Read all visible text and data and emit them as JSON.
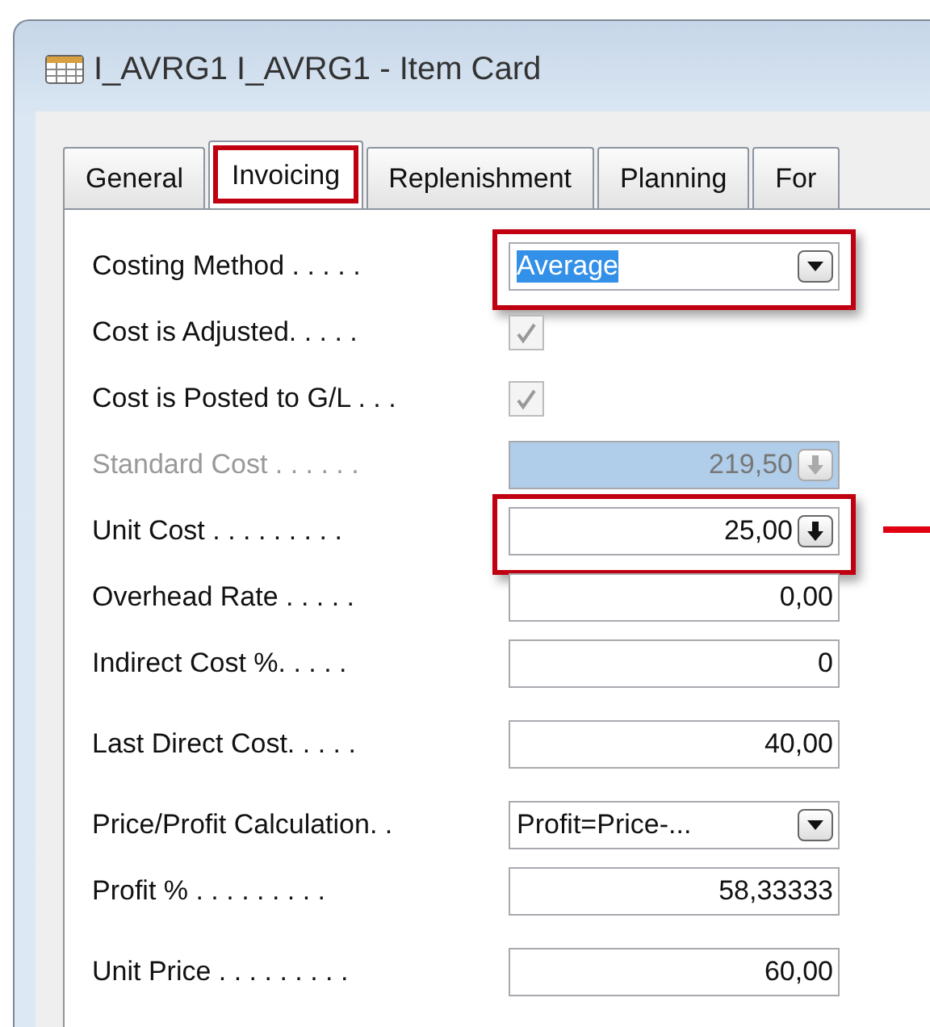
{
  "window": {
    "title": "I_AVRG1 I_AVRG1 - Item Card"
  },
  "tabs": [
    {
      "label": "General",
      "selected": false,
      "highlighted": false
    },
    {
      "label": "Invoicing",
      "selected": true,
      "highlighted": true
    },
    {
      "label": "Replenishment",
      "selected": false,
      "highlighted": false
    },
    {
      "label": "Planning",
      "selected": false,
      "highlighted": false
    },
    {
      "label": "For",
      "selected": false,
      "highlighted": false
    }
  ],
  "fields": [
    {
      "label": "Costing Method . . . . .",
      "kind": "dropdown",
      "value": "Average",
      "text_selected": true,
      "disabled": false,
      "highlighted": true,
      "pointer": false
    },
    {
      "label": "Cost is Adjusted. . . . .",
      "kind": "checkbox",
      "checked": true,
      "disabled": true,
      "highlighted": false,
      "pointer": false
    },
    {
      "label": "Cost is Posted to G/L . . .",
      "kind": "checkbox",
      "checked": true,
      "disabled": true,
      "highlighted": false,
      "pointer": false
    },
    {
      "label": "Standard Cost . . . . . .",
      "kind": "lookup",
      "value": "219,50",
      "disabled": true,
      "highlighted": false,
      "pointer": false
    },
    {
      "label": "Unit Cost . . . . . . . . .",
      "kind": "lookup",
      "value": "25,00",
      "disabled": false,
      "highlighted": true,
      "pointer": true
    },
    {
      "label": "Overhead Rate . . . . .",
      "kind": "number",
      "value": "0,00",
      "disabled": false,
      "highlighted": false,
      "pointer": false
    },
    {
      "label": "Indirect Cost %. . . . .",
      "kind": "number",
      "value": "0",
      "disabled": false,
      "highlighted": false,
      "pointer": false
    },
    {
      "label": "Last Direct Cost. . . . .",
      "kind": "number",
      "value": "40,00",
      "disabled": false,
      "highlighted": false,
      "pointer": false
    },
    {
      "label": "Price/Profit Calculation. .",
      "kind": "dropdown",
      "value": "Profit=Price-...",
      "text_selected": false,
      "disabled": false,
      "highlighted": false,
      "pointer": false
    },
    {
      "label": "Profit % . . . . . . . . .",
      "kind": "number",
      "value": "58,33333",
      "disabled": false,
      "highlighted": false,
      "pointer": false
    },
    {
      "label": "Unit Price . . . . . . . . .",
      "kind": "number",
      "value": "60,00",
      "disabled": false,
      "highlighted": false,
      "pointer": false
    }
  ]
}
